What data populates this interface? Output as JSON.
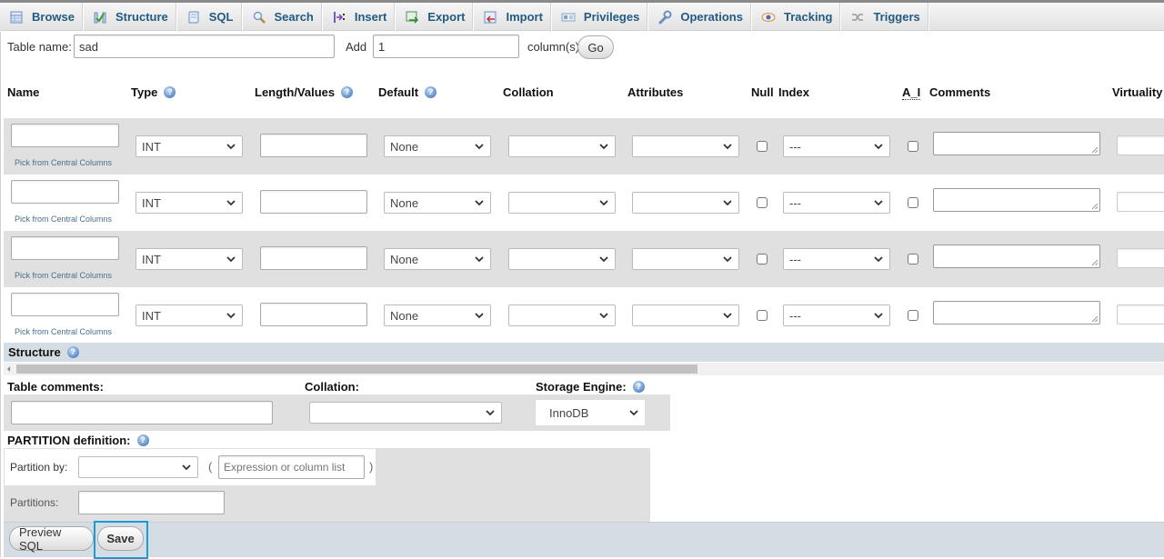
{
  "tabs": [
    {
      "label": "Browse",
      "icon": "browse-icon"
    },
    {
      "label": "Structure",
      "icon": "structure-icon"
    },
    {
      "label": "SQL",
      "icon": "sql-icon"
    },
    {
      "label": "Search",
      "icon": "search-icon"
    },
    {
      "label": "Insert",
      "icon": "insert-icon"
    },
    {
      "label": "Export",
      "icon": "export-icon"
    },
    {
      "label": "Import",
      "icon": "import-icon"
    },
    {
      "label": "Privileges",
      "icon": "privileges-icon"
    },
    {
      "label": "Operations",
      "icon": "operations-icon"
    },
    {
      "label": "Tracking",
      "icon": "tracking-icon"
    },
    {
      "label": "Triggers",
      "icon": "triggers-icon"
    }
  ],
  "table_name": {
    "label": "Table name:",
    "value": "sad"
  },
  "add_columns": {
    "label": "Add",
    "value": "1",
    "suffix": "column(s)",
    "go_label": "Go"
  },
  "headers": {
    "name": "Name",
    "type": "Type",
    "length": "Length/Values",
    "default": "Default",
    "collation": "Collation",
    "attributes": "Attributes",
    "null": "Null",
    "index": "Index",
    "ai": "A_I",
    "comments": "Comments",
    "virtuality": "Virtuality"
  },
  "columns": [
    {
      "name": "",
      "type": "INT",
      "length": "",
      "default": "None",
      "collation": "",
      "attributes": "",
      "null": false,
      "index": "---",
      "ai": false,
      "comments": "",
      "pick_label": "Pick from Central Columns"
    },
    {
      "name": "",
      "type": "INT",
      "length": "",
      "default": "None",
      "collation": "",
      "attributes": "",
      "null": false,
      "index": "---",
      "ai": false,
      "comments": "",
      "pick_label": "Pick from Central Columns"
    },
    {
      "name": "",
      "type": "INT",
      "length": "",
      "default": "None",
      "collation": "",
      "attributes": "",
      "null": false,
      "index": "---",
      "ai": false,
      "comments": "",
      "pick_label": "Pick from Central Columns"
    },
    {
      "name": "",
      "type": "INT",
      "length": "",
      "default": "None",
      "collation": "",
      "attributes": "",
      "null": false,
      "index": "---",
      "ai": false,
      "comments": "",
      "pick_label": "Pick from Central Columns"
    }
  ],
  "structure_label": "Structure",
  "table_options": {
    "comments_label": "Table comments:",
    "comments_value": "",
    "collation_label": "Collation:",
    "collation_value": "",
    "engine_label": "Storage Engine:",
    "engine_value": "InnoDB"
  },
  "partition": {
    "title": "PARTITION definition:",
    "by_label": "Partition by:",
    "by_value": "",
    "open_paren": "(",
    "close_paren": ")",
    "expression_placeholder": "Expression or column list",
    "partitions_label": "Partitions:",
    "partitions_value": ""
  },
  "footer": {
    "preview_label": "Preview SQL",
    "save_label": "Save"
  },
  "colors": {
    "tab_text": "#235a81",
    "row_grey": "#e0e0e0",
    "structure_bar": "#d3dde3",
    "annotation": "#1a9ad6"
  }
}
